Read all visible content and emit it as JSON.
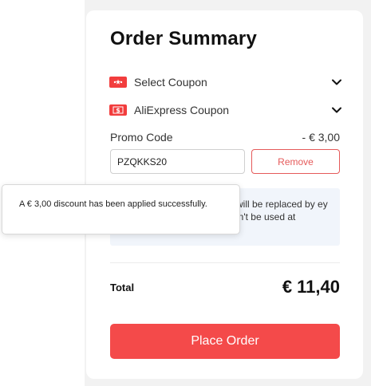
{
  "order_summary": {
    "title": "Order Summary",
    "coupons": [
      {
        "label": "Select Coupon",
        "icon": "coupon-ticket-icon"
      },
      {
        "label": "AliExpress Coupon",
        "icon": "dollar-coupon-icon"
      }
    ],
    "promo": {
      "label": "Promo Code",
      "discount": "- € 3,00",
      "code_value": "PZQKKS20",
      "remove_label": "Remove"
    },
    "info_note_partial": "n will be replaced by ey can't be used at",
    "total_label": "Total",
    "total_value": "€ 11,40",
    "place_order_label": "Place Order"
  },
  "tooltip": {
    "message": "A € 3,00 discount has been applied successfully."
  },
  "colors": {
    "accent_red": "#f44a4a",
    "remove_border": "#e55a5a",
    "info_bg": "#f1f5fb"
  }
}
